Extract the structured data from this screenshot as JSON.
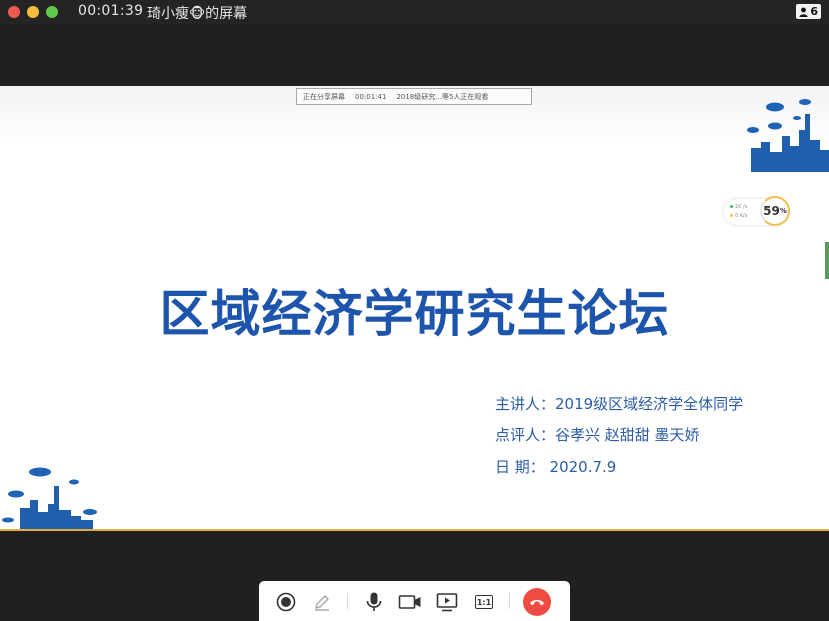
{
  "window": {
    "timer": "00:01:39",
    "title": "琦小瘦🐵的屏幕",
    "participant_count": "6"
  },
  "sharing_bar": {
    "status": "正在分享屏幕",
    "timer": "00:01:41",
    "info": "2018级研究...等5人正在观看"
  },
  "slide": {
    "title": "区域经济学研究生论坛",
    "presenter": "主讲人：2019级区域经济学全体同学",
    "reviewers": "点评人：谷孝兴  赵甜甜  墨天娇",
    "date": "日    期：  2020.7.9"
  },
  "stats": {
    "upload": "1K  /s",
    "download": "0  K/s",
    "value": "59",
    "unit": "%"
  },
  "colors": {
    "title_blue": "#1d55ac",
    "info_blue": "#2b5ca7",
    "accent_gold": "#e0ae43",
    "hangup_red": "#ef4b43"
  },
  "icons": {
    "record": "record-icon",
    "annotate": "pen-icon",
    "mic": "microphone-icon",
    "camera": "camera-icon",
    "share": "screen-share-icon",
    "ratio": "actual-size-icon",
    "leave": "hangup-icon"
  },
  "toolbar": {
    "ratio_label": "1:1"
  }
}
